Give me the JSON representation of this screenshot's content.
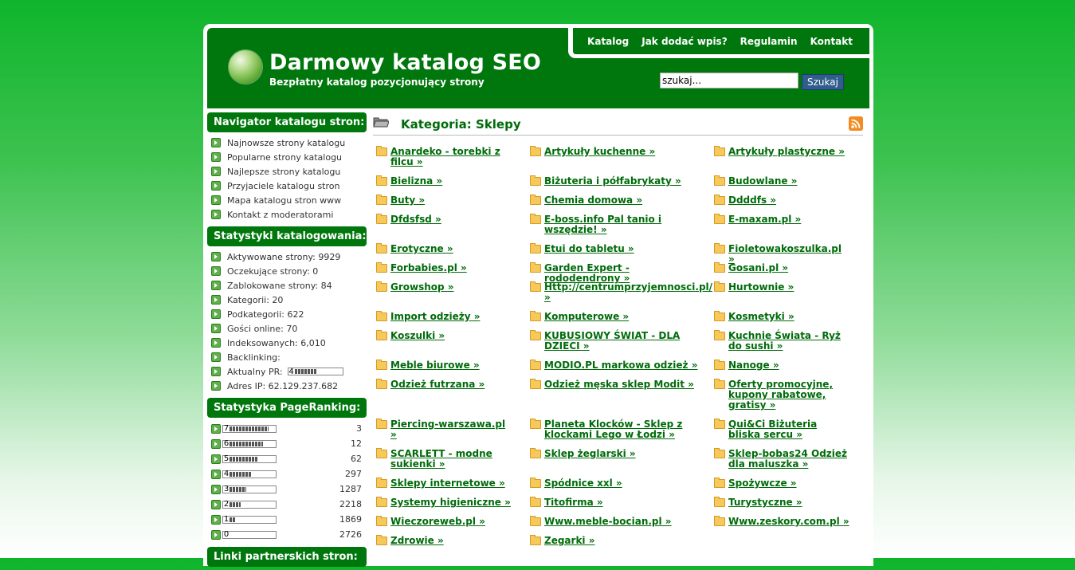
{
  "topnav": [
    {
      "label": "Katalog"
    },
    {
      "label": "Jak dodać wpis?"
    },
    {
      "label": "Regulamin"
    },
    {
      "label": "Kontakt"
    }
  ],
  "header": {
    "title": "Darmowy katalog SEO",
    "subtitle": "Bezpłatny katalog pozycjonujący strony"
  },
  "search": {
    "placeholder": "szukaj...",
    "button": "Szukaj"
  },
  "sidebar": {
    "nav_title": "Navigator katalogu stron:",
    "nav_items": [
      "Najnowsze strony katalogu",
      "Popularne strony katalogu",
      "Najlepsze strony katalogu",
      "Przyjaciele katalogu stron",
      "Mapa katalogu stron www",
      "Kontakt z moderatorami"
    ],
    "stats_title": "Statystyki katalogowania:",
    "stats": [
      "Aktywowane strony: 9929",
      "Oczekujące strony: 0",
      "Zablokowane strony: 84",
      "Kategorii: 20",
      "Podkategorii: 622",
      "Gości online: 70",
      "Indeksowanych: 6,010",
      "Backlinking:"
    ],
    "pr_label": "Aktualny PR:",
    "pr_value": "4",
    "ip": "Adres IP: 62.129.237.682",
    "pagerank_title": "Statystyka PageRanking:",
    "pagerank": [
      {
        "rank": "7",
        "count": "3"
      },
      {
        "rank": "6",
        "count": "12"
      },
      {
        "rank": "5",
        "count": "62"
      },
      {
        "rank": "4",
        "count": "297"
      },
      {
        "rank": "3",
        "count": "1287"
      },
      {
        "rank": "2",
        "count": "2218"
      },
      {
        "rank": "1",
        "count": "1869"
      },
      {
        "rank": "0",
        "count": "2726"
      }
    ],
    "partners_title": "Linki partnerskich stron:"
  },
  "main": {
    "category_title": "Kategoria: Sklepy",
    "categories": [
      [
        "Anardeko - torebki z filcu »",
        "Artykuły kuchenne »",
        "Artykuły plastyczne »"
      ],
      [
        "Bielizna »",
        "Biżuteria i półfabrykaty »",
        "Budowlane »"
      ],
      [
        "Buty »",
        "Chemia domowa »",
        "Ddddfs »"
      ],
      [
        "Dfdsfsd »",
        "E-boss.info Pal tanio i wszędzie! »",
        "E-maxam.pl »"
      ],
      [
        "Erotyczne »",
        "Etui do tabletu »",
        "Fioletowakoszulka.pl »"
      ],
      [
        "Forbabies.pl »",
        "Garden Expert - rododendrony »",
        "Gosani.pl »"
      ],
      [
        "Growshop »",
        "Http://centrumprzyjemnosci.pl/ »",
        "Hurtownie »"
      ],
      [
        "Import odzieży »",
        "Komputerowe »",
        "Kosmetyki »"
      ],
      [
        "Koszulki »",
        "KUBUSIOWY ŚWIAT - DLA DZIECI »",
        "Kuchnie Świata - Ryż do sushi »"
      ],
      [
        "Meble biurowe »",
        "MODIO.PL markowa odzież »",
        "Nanoge »"
      ],
      [
        "Odzież futrzana »",
        "Odzież męska sklep Modit »",
        "Oferty promocyjne, kupony rabatowe, gratisy »"
      ],
      [
        "Piercing-warszawa.pl »",
        "Planeta Klocków - Sklep z klockami Lego w Łodzi »",
        "Qui&Ci Biżuteria bliska sercu »"
      ],
      [
        "SCARLETT - modne sukienki »",
        "Sklep żeglarski »",
        "Sklep-bobas24 Odzież dla maluszka »"
      ],
      [
        "Sklepy internetowe »",
        "Spódnice xxl »",
        "Spożywcze »"
      ],
      [
        "Systemy higieniczne »",
        "Titofirma »",
        "Turystyczne »"
      ],
      [
        "Wieczoreweb.pl »",
        "Www.meble-bocian.pl »",
        "Www.zeskory.com.pl »"
      ],
      [
        "Zdrowie »",
        "Zegarki »",
        ""
      ]
    ]
  }
}
